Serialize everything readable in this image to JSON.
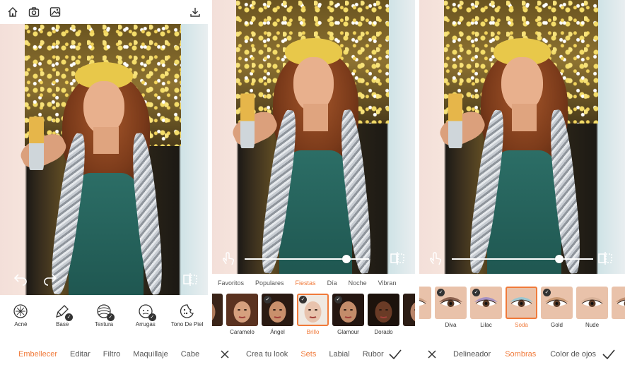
{
  "colors": {
    "accent": "#f07a3a",
    "text": "#333333",
    "muted": "#555555"
  },
  "panel1": {
    "top_icons": [
      "home-icon",
      "camera-icon",
      "gallery-icon",
      "download-icon"
    ],
    "photo_overlay_icons": [
      "undo-icon",
      "redo-icon",
      "compare-icon"
    ],
    "tools": [
      {
        "label": "Acné",
        "icon": "acne-icon",
        "checked": false
      },
      {
        "label": "Base",
        "icon": "base-brush-icon",
        "checked": true
      },
      {
        "label": "Textura",
        "icon": "texture-icon",
        "checked": true
      },
      {
        "label": "Arrugas",
        "icon": "wrinkles-icon",
        "checked": true
      },
      {
        "label": "Tono De Piel",
        "icon": "skin-tone-icon",
        "checked": false
      }
    ],
    "nav": [
      {
        "label": "Embellecer",
        "active": true
      },
      {
        "label": "Editar",
        "active": false
      },
      {
        "label": "Filtro",
        "active": false
      },
      {
        "label": "Maquillaje",
        "active": false
      },
      {
        "label": "Cabe",
        "active": false
      }
    ]
  },
  "panel2": {
    "slider_value": 0.82,
    "overlay_icons": [
      "hand-touch-icon",
      "compare-icon"
    ],
    "tabs": [
      {
        "label": "Favoritos",
        "active": false
      },
      {
        "label": "Populares",
        "active": false
      },
      {
        "label": "Fiestas",
        "active": true
      },
      {
        "label": "Día",
        "active": false
      },
      {
        "label": "Noche",
        "active": false
      },
      {
        "label": "Vibran",
        "active": false
      }
    ],
    "looks": [
      {
        "name": "ía",
        "skin": "#b07a5a",
        "hair": "#3a2418",
        "checked": false,
        "selected": false
      },
      {
        "name": "Caramelo",
        "skin": "#d6a07e",
        "hair": "#5a3220",
        "checked": false,
        "selected": false
      },
      {
        "name": "Ángel",
        "skin": "#c9906c",
        "hair": "#2a1a12",
        "checked": true,
        "selected": false
      },
      {
        "name": "Brillo",
        "skin": "#e8c3ad",
        "hair": "#efe9e2",
        "checked": true,
        "selected": true
      },
      {
        "name": "Glamour",
        "skin": "#c48c6a",
        "hair": "#241611",
        "checked": true,
        "selected": false
      },
      {
        "name": "Dorado",
        "skin": "#6a3b26",
        "hair": "#1c120c",
        "checked": false,
        "selected": false
      },
      {
        "name": "E",
        "skin": "#b9856a",
        "hair": "#2b1c14",
        "checked": false,
        "selected": false
      }
    ],
    "nav": [
      {
        "label": "Crea tu look",
        "active": false
      },
      {
        "label": "Sets",
        "active": true
      },
      {
        "label": "Labial",
        "active": false
      },
      {
        "label": "Rubor",
        "active": false
      }
    ],
    "cancel_icon": "close-icon",
    "confirm_icon": "checkmark-icon"
  },
  "panel3": {
    "slider_value": 0.76,
    "overlay_icons": [
      "hand-touch-icon",
      "compare-icon"
    ],
    "eyeshadows": [
      {
        "name": "ve",
        "lid": "#c79a7e",
        "checked": false,
        "selected": false
      },
      {
        "name": "Diva",
        "lid": "#7a5040",
        "checked": true,
        "selected": false
      },
      {
        "name": "Lilac",
        "lid": "#9a8ac8",
        "checked": true,
        "selected": false
      },
      {
        "name": "Soda",
        "lid": "#8ec8d8",
        "checked": false,
        "selected": true
      },
      {
        "name": "Gold",
        "lid": "#c4926a",
        "checked": true,
        "selected": false
      },
      {
        "name": "Nude",
        "lid": "#d6b098",
        "checked": false,
        "selected": false
      },
      {
        "name": "C",
        "lid": "#b48060",
        "checked": false,
        "selected": false
      }
    ],
    "nav": [
      {
        "label": "Delineador",
        "active": false
      },
      {
        "label": "Sombras",
        "active": true
      },
      {
        "label": "Color de ojos",
        "active": false
      }
    ],
    "cancel_icon": "close-icon",
    "confirm_icon": "checkmark-icon"
  }
}
